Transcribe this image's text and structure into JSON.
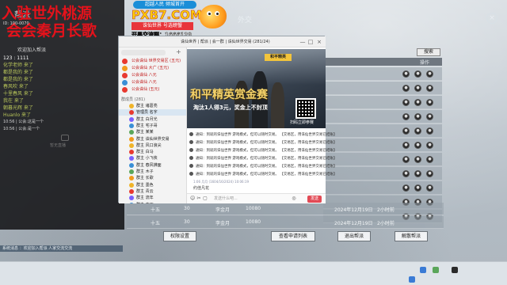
{
  "game": {
    "panel_title": "外交",
    "close_glyph": "×",
    "table": {
      "search_label": "搜索",
      "header_action": "操作",
      "action_glyph": "●"
    },
    "bottom_rows": [
      {
        "name": "十五",
        "level": "30",
        "leader": "李金月",
        "members": "10080",
        "date": "2024年12月19日",
        "time": "2小时前"
      },
      {
        "name": "十五",
        "level": "30",
        "leader": "李金月",
        "members": "10080",
        "date": "2024年12月19日",
        "time": "2小时前"
      }
    ],
    "buttons": {
      "rights_settings": "权限设置",
      "view_applications": "查看申请列表",
      "quit_gang": "退出帮派",
      "disband_gang": "解散帮派"
    },
    "status_text": "系统消息 ：欢迎加入帮派 人家交流交流"
  },
  "chat_panel": {
    "banner_line1": "入驻世外桃源",
    "banner_line2": "会会秦月长歌",
    "faction_label": "帮派",
    "user_line": "ID: 100-0070",
    "welcome": "欢迎加入帮派",
    "lines": [
      {
        "kind": "first",
        "text": "123 : 1111"
      },
      {
        "kind": "msg",
        "text": "化学老师 来了"
      },
      {
        "kind": "msg",
        "text": "都是我的 来了"
      },
      {
        "kind": "msg",
        "text": "都是我的 来了"
      },
      {
        "kind": "msg",
        "text": "春风吹 来了"
      },
      {
        "kind": "msg",
        "text": "十里春风 来了"
      },
      {
        "kind": "msg",
        "text": "我在 来了"
      },
      {
        "kind": "msg",
        "text": "朝暮光辉 来了"
      },
      {
        "kind": "msg",
        "text": "Huanlo 来了"
      },
      {
        "kind": "sys",
        "text": "10:56 | 公会:这是一个"
      },
      {
        "kind": "sys",
        "text": "10:56 | 公会:是一个"
      }
    ],
    "video_hint": "暂无直播"
  },
  "ad": {
    "top_pill": "超越人民 倾城首开",
    "brand": "PXB7.COM",
    "sub": "诛仙世界 号选螃蟹",
    "group": "开黑交流群：1666129"
  },
  "qq": {
    "title": "诛仙世界 | 帮派 | 会一群 | 诛仙世界交易 (281/24)",
    "window_controls": [
      "—",
      "□",
      "×"
    ],
    "plus": "+",
    "pinned": [
      "公会诛仙 世界交易区 (五元)",
      "公会诛仙 大广 (五元)",
      "公会诛仙 八元",
      "公会诛仙 八元",
      "公会诛仙 (五元)"
    ],
    "section_label": "群成员 (281)",
    "members": [
      "群主 诸葛亮",
      "管理员 名字",
      "群主 白月光",
      "群主 宅子哥",
      "群主 某某",
      "群主 诛仙世界交易",
      "群主 风口浪尖",
      "群主 白马",
      "群主 小飞侠",
      "群主 春风拂面",
      "群主 木子",
      "群主 长歌",
      "群主 墨色",
      "群主 青云",
      "群主 流年",
      "群主 夜雨",
      "群主 白露",
      "群主 天涯",
      "群主 海角",
      "群主 星辰",
      "群主 十五",
      "群主 十六"
    ],
    "ad": {
      "logo": "和平精英",
      "headline": "和平精英赏金赛",
      "subline": "淘汰1人得3元，奖金上不封顶",
      "scan": "扫码立即参赛"
    },
    "messages": [
      "通知：到就的诛仙世界 游戏模式，但可以随时交易。 【交易区，用诛仙世界交易已结账】",
      "通知：到就的诛仙世界 游戏模式，但可以随时交易。 【交易区，用诛仙世界交易已结账】",
      "通知：到就的诛仙世界 游戏模式，但可以随时交易。 【交易区，用诛仙世界交易已结账】",
      "通知：到就的诛仙世界 游戏模式，但可以随时交易。 【交易区，用诛仙世界交易已结账】",
      "通知：到就的诛仙世界 游戏模式，但可以随时交易。 【交易区，用诛仙世界交易已结账】",
      "通知：到就的诛仙世界 游戏模式，但可以随时交易。 【交易区，用诛仙世界交易已结账】"
    ],
    "recall": "1:06 月月 (1604/16/2024) 10:06:19",
    "reply": "约佳凡花",
    "input_placeholder": "发送什么吧...",
    "send_label": "发送",
    "tools": [
      "☺",
      "✂",
      "▢",
      "◎"
    ]
  },
  "colors": {
    "banner_red": "#e4121b",
    "chat_green": "#b9c65a",
    "qq_send": "#e24a55",
    "ad_gold": "#f5d36a"
  }
}
